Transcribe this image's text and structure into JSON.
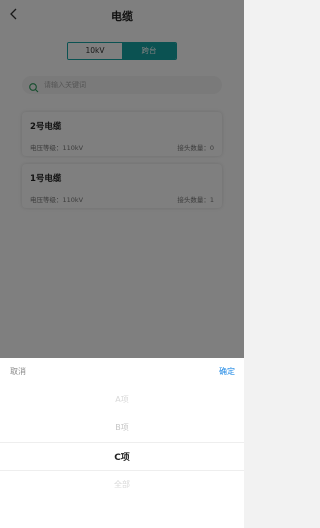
{
  "header": {
    "title": "电缆"
  },
  "tabs": [
    {
      "label": "10kV",
      "active": false
    },
    {
      "label": "跨台",
      "active": true
    }
  ],
  "search": {
    "placeholder": "请输入关键词"
  },
  "cables": [
    {
      "name": "2号电缆",
      "voltage": "电压等级：110kV",
      "joints": "接头数量：0"
    },
    {
      "name": "1号电缆",
      "voltage": "电压等级：110kV",
      "joints": "接头数量：1"
    }
  ],
  "picker": {
    "cancel_label": "取消",
    "confirm_label": "确定",
    "options": [
      "A项",
      "B项",
      "C项",
      "全部"
    ],
    "selected": "C项"
  },
  "colors": {
    "accent": "#17a4a4",
    "confirm": "#1e88e5"
  },
  "icons": {
    "back": "chevron-left-icon",
    "search": "search-icon"
  }
}
